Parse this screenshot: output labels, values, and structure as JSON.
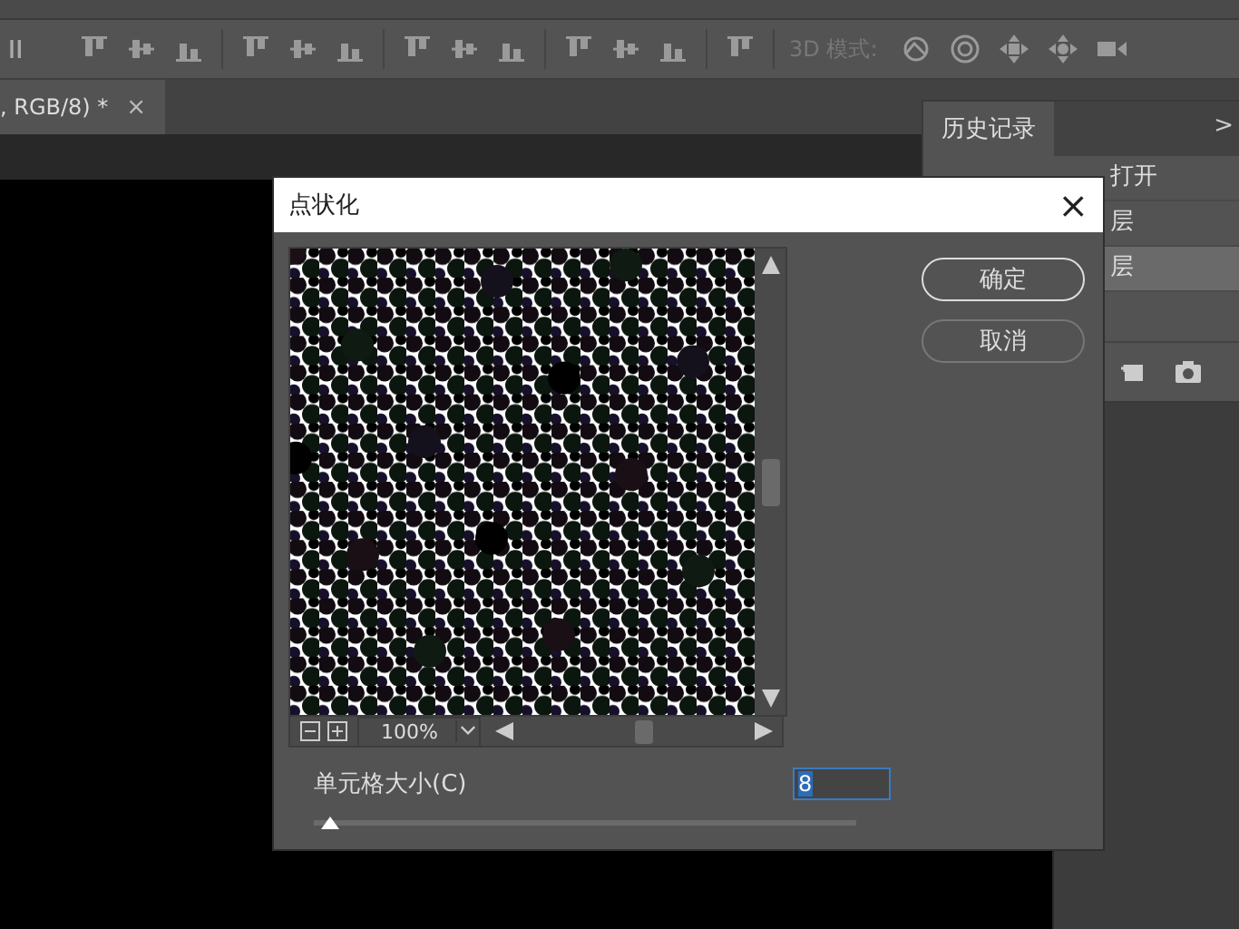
{
  "toolbar": {
    "mode_label": "3D 模式:"
  },
  "document_tab": {
    "title": ", RGB/8) *",
    "close": "×"
  },
  "history_panel": {
    "title": "历史记录",
    "collapse": ">",
    "items": [
      {
        "label": "打开",
        "selected": false
      },
      {
        "label": "层",
        "selected": false
      },
      {
        "label": "层",
        "selected": true
      }
    ]
  },
  "dialog": {
    "title": "点状化",
    "close": "×",
    "buttons": [
      {
        "label": "确定",
        "kind": "primary"
      },
      {
        "label": "取消",
        "kind": "secondary"
      }
    ],
    "preview": {
      "zoom": "100%"
    },
    "cell_size": {
      "label": "单元格大小(C)",
      "value": "8",
      "level": 0.02
    }
  }
}
